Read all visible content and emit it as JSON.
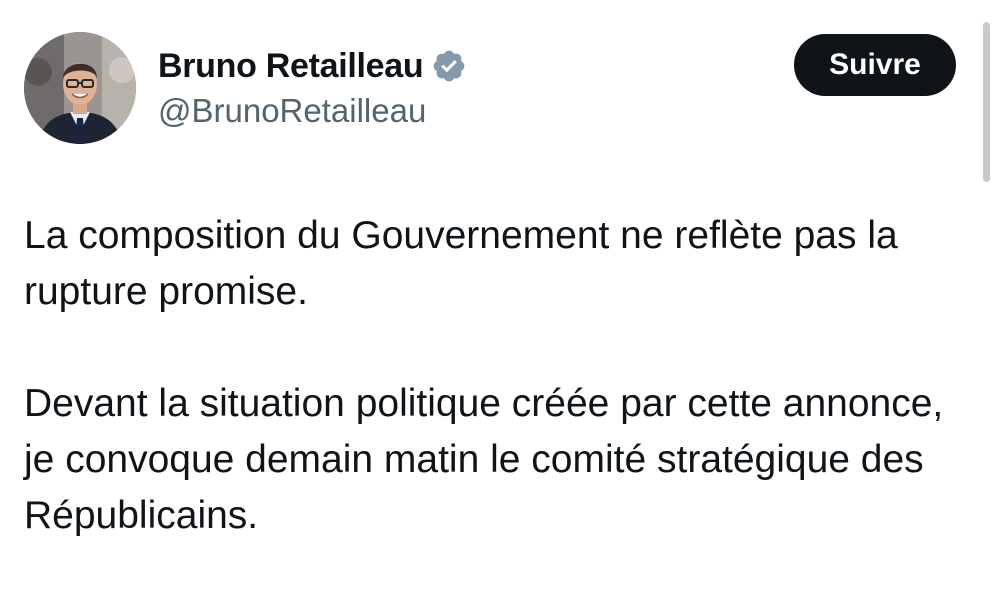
{
  "tweet": {
    "author": {
      "display_name": "Bruno Retailleau",
      "handle": "@BrunoRetailleau",
      "verified_icon": "verified-badge-icon",
      "verified_color": "#829aab"
    },
    "follow_label": "Suivre",
    "paragraphs": [
      "La composition du Gouvernement ne reflète pas la rupture promise.",
      "Devant la situation politique créée par cette annonce, je convoque demain matin le comité stratégique des Républicains."
    ]
  }
}
